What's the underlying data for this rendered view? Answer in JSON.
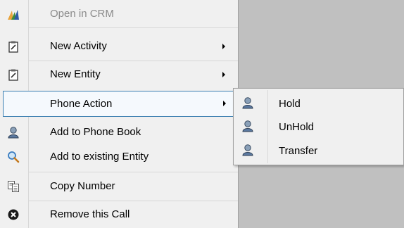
{
  "context_menu": {
    "items": [
      {
        "label": "Open in CRM",
        "icon": "crm-logo-icon",
        "enabled": false
      },
      {
        "label": "New Activity",
        "icon": "clipboard-icon",
        "has_submenu": true
      },
      {
        "label": "New Entity",
        "icon": "clipboard-icon",
        "has_submenu": true
      },
      {
        "label": "Phone Action",
        "icon": "none",
        "has_submenu": true,
        "highlighted": true
      },
      {
        "label": "Add to Phone Book",
        "icon": "user-icon"
      },
      {
        "label": "Add to existing Entity",
        "icon": "magnifier-icon"
      },
      {
        "label": "Copy Number",
        "icon": "copy-icon"
      },
      {
        "label": "Remove this Call",
        "icon": "remove-icon"
      }
    ]
  },
  "phone_action_submenu": {
    "items": [
      {
        "label": "Hold",
        "icon": "user-icon"
      },
      {
        "label": "UnHold",
        "icon": "user-icon"
      },
      {
        "label": "Transfer",
        "icon": "user-icon"
      }
    ]
  },
  "colors": {
    "menu_bg": "#f0f0f0",
    "highlight_border": "#3c7fb1",
    "disabled_text": "#8a8a8a",
    "background": "#c0c0c0"
  }
}
